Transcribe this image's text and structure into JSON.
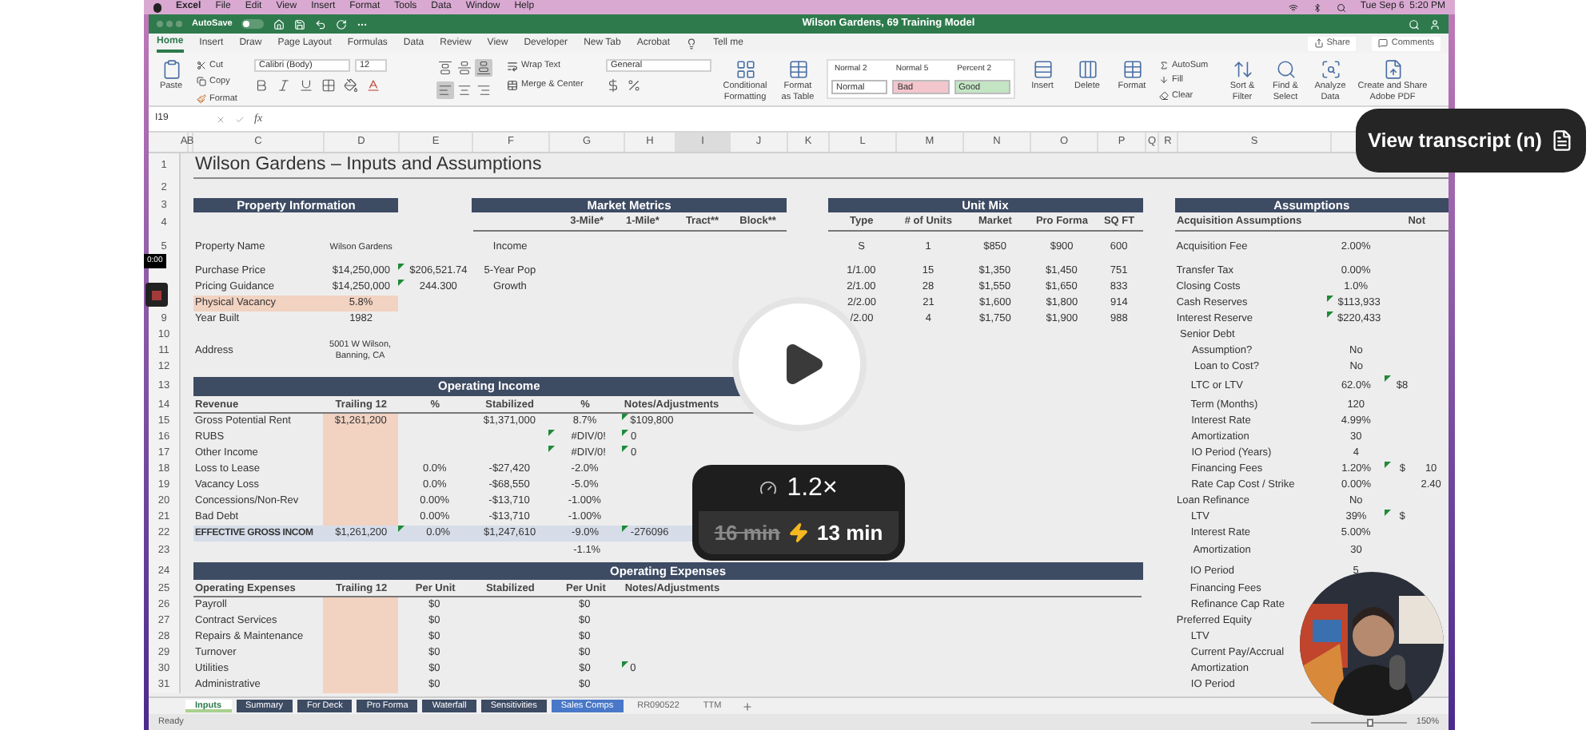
{
  "menubar": {
    "items": [
      "Excel",
      "File",
      "Edit",
      "View",
      "Insert",
      "Format",
      "Tools",
      "Data",
      "Window",
      "Help"
    ],
    "clock": "Tue Sep 6  5:20 PM"
  },
  "titlebar": {
    "autosave": "AutoSave",
    "autosave_on": false,
    "title": "Wilson Gardens, 69 Training Model"
  },
  "ribbon_tabs": [
    {
      "label": "Home",
      "selected": true
    },
    {
      "label": "Insert",
      "selected": false
    },
    {
      "label": "Draw",
      "selected": false
    },
    {
      "label": "Page Layout",
      "selected": false
    },
    {
      "label": "Formulas",
      "selected": false
    },
    {
      "label": "Data",
      "selected": false
    },
    {
      "label": "Review",
      "selected": false
    },
    {
      "label": "View",
      "selected": false
    },
    {
      "label": "Developer",
      "selected": false
    },
    {
      "label": "New Tab",
      "selected": false
    },
    {
      "label": "Acrobat",
      "selected": false
    }
  ],
  "tell_me": "Tell me",
  "share": "Share",
  "comments": "Comments",
  "ribbon": {
    "paste": "Paste",
    "cut": "Cut",
    "copy": "Copy",
    "format_painter": "Format",
    "font_name": "Calibri (Body)",
    "font_size": "12",
    "vertical_align": [
      {
        "kind": "top",
        "selected": false
      },
      {
        "kind": "middle",
        "selected": false
      },
      {
        "kind": "bottom",
        "selected": true
      }
    ],
    "horizontal_align": [
      {
        "kind": "left",
        "selected": true
      },
      {
        "kind": "center",
        "selected": false
      },
      {
        "kind": "right",
        "selected": false
      }
    ],
    "wrap_text": "Wrap Text",
    "merge_center": "Merge & Center",
    "number_format": "General",
    "conditional_formatting": "Conditional Formatting",
    "format_as_table": "Format as Table",
    "styles": [
      {
        "label": "Normal 2"
      },
      {
        "label": "Normal 5"
      },
      {
        "label": "Percent 2"
      },
      {
        "label": "Normal",
        "color": "#ffffff"
      },
      {
        "label": "Bad",
        "color": "#f3c5cc"
      },
      {
        "label": "Good",
        "color": "#c3e5c4"
      }
    ],
    "insert": "Insert",
    "delete": "Delete",
    "format": "Format",
    "autosum": "AutoSum",
    "fill": "Fill",
    "clear": "Clear",
    "sort_filter": "Sort & Filter",
    "find_select": "Find & Select",
    "analyze_data": "Analyze Data",
    "adobe_pdf": "Create and Share Adobe PDF"
  },
  "formula_bar": {
    "cell": "I19",
    "fx": "fx"
  },
  "sheet": {
    "columns": [
      "A",
      "B",
      "C",
      "D",
      "E",
      "F",
      "G",
      "H",
      "I",
      "J",
      "K",
      "L",
      "M",
      "N",
      "O",
      "P",
      "Q",
      "R",
      "S"
    ],
    "rows": [
      {
        "number": "1",
        "cells": [
          {
            "kind": "title",
            "text": "Wilson Gardens – Inputs and Assumptions"
          }
        ]
      },
      {
        "number": "2"
      },
      {
        "number": "3",
        "cells": [
          {
            "kind": "band",
            "text": "Property Information"
          },
          {
            "kind": "band",
            "text": "Market Metrics"
          },
          {
            "kind": "band",
            "text": "Unit Mix"
          },
          {
            "kind": "band",
            "text": "Assumptions"
          }
        ]
      },
      {
        "number": "4",
        "cells": [
          {
            "kind": "head"
          },
          {
            "kind": "head",
            "text": "3-Mile*"
          },
          {
            "kind": "head",
            "text": "1-Mile*"
          },
          {
            "kind": "head",
            "text": "Tract**"
          },
          {
            "kind": "head",
            "text": "Block**"
          },
          {
            "kind": "head",
            "text": "Type"
          },
          {
            "kind": "head",
            "text": "# of Units"
          },
          {
            "kind": "head",
            "text": "Market"
          },
          {
            "kind": "head",
            "text": "Pro Forma"
          },
          {
            "kind": "head",
            "text": "SQ FT"
          },
          {
            "kind": "head",
            "text": "Acquisition Assumptions"
          },
          {
            "kind": "head"
          },
          {
            "kind": "head",
            "text": "Not"
          }
        ]
      },
      {
        "number": "5",
        "cells": [
          {
            "text": "Property Name"
          },
          {
            "kind": "small",
            "text": "Wilson Gardens"
          },
          {
            "text": "Income"
          },
          {
            "text": "S"
          },
          {
            "text": "1"
          },
          {
            "text": "$850"
          },
          {
            "text": "$900"
          },
          {
            "text": "600"
          },
          {
            "text": "Acquisition Fee"
          },
          {
            "text": "2.00%"
          }
        ]
      },
      {
        "cells": [
          {
            "text": "Purchase Price"
          },
          {
            "text": "$14,250,000"
          },
          {
            "text": "$206,521.74",
            "comment": true
          },
          {
            "text": "5-Year Pop"
          },
          {
            "text": "1/1.00"
          },
          {
            "text": "15"
          },
          {
            "text": "$1,350"
          },
          {
            "text": "$1,450"
          },
          {
            "text": "751"
          },
          {
            "text": "Transfer Tax"
          },
          {
            "text": "0.00%"
          }
        ]
      },
      {
        "cells": [
          {
            "text": "Pricing Guidance"
          },
          {
            "text": "$14,250,000"
          },
          {
            "text": "244.300",
            "comment": true
          },
          {
            "text": "Growth"
          },
          {
            "text": "2/1.00"
          },
          {
            "text": "28"
          },
          {
            "text": "$1,550"
          },
          {
            "text": "$1,650"
          },
          {
            "text": "833"
          },
          {
            "text": "Closing Costs"
          },
          {
            "text": "1.0%"
          }
        ]
      },
      {
        "cells": [
          {
            "text": "Physical Vacancy",
            "input": true
          },
          {
            "text": "5.8%",
            "input": true
          },
          {
            "text": "2/2.00"
          },
          {
            "text": "21"
          },
          {
            "text": "$1,600"
          },
          {
            "text": "$1,800"
          },
          {
            "text": "914"
          },
          {
            "text": "Cash Reserves"
          },
          {
            "text": "$113,933",
            "comment": true
          }
        ]
      },
      {
        "number": "9",
        "cells": [
          {
            "text": "Year Built"
          },
          {
            "text": "1982"
          },
          {
            "text": "/2.00"
          },
          {
            "text": "4"
          },
          {
            "text": "$1,750"
          },
          {
            "text": "$1,900"
          },
          {
            "text": "988"
          },
          {
            "text": "Interest Reserve"
          },
          {
            "text": "$220,433",
            "comment": true
          }
        ]
      },
      {
        "number": "10",
        "cells": [
          {
            "text": "Senior Debt"
          }
        ]
      },
      {
        "number": "11",
        "cells": [
          {
            "text": "Address"
          },
          {
            "kind": "wrap",
            "text": "5001 W Wilson, Banning, CA"
          },
          {
            "kind": "sub",
            "text": "Assumption?"
          },
          {
            "text": "No"
          }
        ]
      },
      {
        "number": "12",
        "cells": [
          {
            "kind": "sub",
            "text": "Loan to Cost?"
          },
          {
            "text": "No"
          }
        ]
      },
      {
        "number": "13",
        "cells": [
          {
            "kind": "band",
            "text": "Operating Income"
          },
          {
            "kind": "sub",
            "text": "LTC or LTV"
          },
          {
            "text": "62.0%"
          },
          {
            "text": "$8",
            "comment": true
          }
        ]
      },
      {
        "number": "14",
        "cells": [
          {
            "kind": "head",
            "text": "Revenue"
          },
          {
            "kind": "head",
            "text": "Trailing 12"
          },
          {
            "kind": "head",
            "text": "%"
          },
          {
            "kind": "head",
            "text": "Stabilized"
          },
          {
            "kind": "head",
            "text": "%"
          },
          {
            "kind": "head",
            "text": "Notes/Adjustments"
          },
          {
            "kind": "sub",
            "text": "Term (Months)"
          },
          {
            "text": "120"
          }
        ]
      },
      {
        "number": "15",
        "cells": [
          {
            "text": "Gross Potential Rent"
          },
          {
            "text": "$1,261,200",
            "input": true
          },
          {
            "text": "$1,371,000"
          },
          {
            "text": "8.7%"
          },
          {
            "text": "$109,800",
            "comment": true
          },
          {
            "kind": "sub",
            "text": "Interest Rate"
          },
          {
            "text": "4.99%"
          }
        ]
      },
      {
        "number": "16",
        "cells": [
          {
            "text": "RUBS"
          },
          {
            "input": true
          },
          {
            "text": "#DIV/0!",
            "comment": true
          },
          {
            "text": "0",
            "comment": true
          },
          {
            "kind": "sub",
            "text": "Amortization"
          },
          {
            "text": "30"
          }
        ]
      },
      {
        "number": "17",
        "cells": [
          {
            "text": "Other Income"
          },
          {
            "input": true
          },
          {
            "text": "#DIV/0!",
            "comment": true
          },
          {
            "text": "0",
            "comment": true
          },
          {
            "kind": "sub",
            "text": "IO Period (Years)"
          },
          {
            "text": "4"
          }
        ]
      },
      {
        "number": "18",
        "cells": [
          {
            "text": "Loss to Lease"
          },
          {
            "input": true
          },
          {
            "text": "0.0%"
          },
          {
            "text": "-$27,420"
          },
          {
            "text": "-2.0%"
          },
          {
            "kind": "sub",
            "text": "Financing Fees"
          },
          {
            "text": "1.20%"
          },
          {
            "text": "$",
            "comment": true
          },
          {
            "text": "10"
          }
        ]
      },
      {
        "number": "19",
        "cells": [
          {
            "text": "Vacancy Loss"
          },
          {
            "input": true
          },
          {
            "text": "0.0%"
          },
          {
            "text": "-$68,550"
          },
          {
            "text": "-5.0%"
          },
          {
            "kind": "sub",
            "text": "Rate Cap Cost / Strike"
          },
          {
            "text": "0.00%"
          },
          {
            "text": "2.40"
          }
        ]
      },
      {
        "number": "20",
        "cells": [
          {
            "text": "Concessions/Non-Rev"
          },
          {
            "input": true
          },
          {
            "text": "0.00%"
          },
          {
            "text": "-$13,710"
          },
          {
            "text": "-1.00%"
          },
          {
            "text": "Loan Refinance"
          },
          {
            "text": "No"
          }
        ]
      },
      {
        "number": "21",
        "cells": [
          {
            "text": "Bad Debt"
          },
          {
            "input": true
          },
          {
            "text": "0.00%"
          },
          {
            "text": "-$13,710"
          },
          {
            "text": "-1.00%"
          },
          {
            "kind": "sub",
            "text": "LTV"
          },
          {
            "text": "39%"
          },
          {
            "text": "$",
            "comment": true
          }
        ]
      },
      {
        "number": "22",
        "cells": [
          {
            "text": "EFFECTIVE GROSS INCOM",
            "bold": true,
            "highlight": true
          },
          {
            "text": "$1,261,200",
            "highlight": true
          },
          {
            "text": "0.0%",
            "highlight": true,
            "comment": true
          },
          {
            "text": "$1,247,610",
            "highlight": true
          },
          {
            "text": "-9.0%",
            "highlight": true
          },
          {
            "text": "-276096",
            "highlight": true,
            "comment": true
          },
          {
            "highlight": true
          },
          {
            "kind": "sub",
            "text": "Interest Rate"
          },
          {
            "text": "5.00%"
          }
        ]
      },
      {
        "number": "23",
        "cells": [
          {
            "text": "-1.1%"
          },
          {
            "kind": "sub",
            "text": "Amortization"
          },
          {
            "text": "30"
          }
        ]
      },
      {
        "number": "24",
        "cells": [
          {
            "kind": "band",
            "text": "Operating Expenses"
          },
          {
            "kind": "sub",
            "text": "IO Period"
          },
          {
            "text": "5"
          }
        ]
      },
      {
        "number": "25",
        "cells": [
          {
            "kind": "head",
            "text": "Operating Expenses"
          },
          {
            "kind": "head",
            "text": "Trailing 12"
          },
          {
            "kind": "head",
            "text": "Per Unit"
          },
          {
            "kind": "head",
            "text": "Stabilized"
          },
          {
            "kind": "head",
            "text": "Per Unit"
          },
          {
            "kind": "head",
            "text": "Notes/Adjustments"
          },
          {
            "kind": "sub",
            "text": "Financing Fees"
          }
        ]
      },
      {
        "number": "26",
        "cells": [
          {
            "text": "Payroll"
          },
          {
            "input": true
          },
          {
            "text": "$0"
          },
          {
            "text": "$0"
          },
          {
            "kind": "sub",
            "text": "Refinance Cap Rate"
          }
        ]
      },
      {
        "number": "27",
        "cells": [
          {
            "text": "Contract Services"
          },
          {
            "input": true
          },
          {
            "text": "$0"
          },
          {
            "text": "$0"
          },
          {
            "text": "Preferred Equity"
          }
        ]
      },
      {
        "number": "28",
        "cells": [
          {
            "text": "Repairs & Maintenance"
          },
          {
            "input": true
          },
          {
            "text": "$0"
          },
          {
            "text": "$0"
          },
          {
            "kind": "sub",
            "text": "LTV"
          }
        ]
      },
      {
        "number": "29",
        "cells": [
          {
            "text": "Turnover"
          },
          {
            "input": true
          },
          {
            "text": "$0"
          },
          {
            "text": "$0"
          },
          {
            "kind": "sub",
            "text": "Current Pay/Accrual"
          }
        ]
      },
      {
        "number": "30",
        "cells": [
          {
            "text": "Utilities"
          },
          {
            "input": true
          },
          {
            "text": "$0"
          },
          {
            "text": "$0"
          },
          {
            "text": "0",
            "comment": true
          },
          {
            "kind": "sub",
            "text": "Amortization"
          }
        ]
      },
      {
        "number": "31",
        "cells": [
          {
            "text": "Administrative"
          },
          {
            "input": true
          },
          {
            "text": "$0"
          },
          {
            "text": "$0"
          },
          {
            "kind": "sub",
            "text": "IO Period"
          }
        ]
      }
    ]
  },
  "sheet_tabs": [
    {
      "label": "Inputs",
      "selected": true,
      "color": "#a9d08e"
    },
    {
      "label": "Summary",
      "selected": false,
      "color": "#3d4b63"
    },
    {
      "label": "For Deck",
      "selected": false,
      "color": "#3d4b63"
    },
    {
      "label": "Pro Forma",
      "selected": false,
      "color": "#3d4b63"
    },
    {
      "label": "Waterfall",
      "selected": false,
      "color": "#3d4b63"
    },
    {
      "label": "Sensitivities",
      "selected": false,
      "color": "#3d4b63"
    },
    {
      "label": "Sales Comps",
      "selected": false,
      "color": "#4a78c8"
    },
    {
      "label": "RR090522",
      "selected": false
    },
    {
      "label": "TTM",
      "selected": false
    }
  ],
  "status": {
    "text": "Ready",
    "zoom": "150%",
    "zoom_slider": {
      "level": 0.62
    }
  },
  "player": {
    "time": "0:00",
    "transcript": "View transcript (n)",
    "rate": "1.2×",
    "old_duration": "16 min",
    "new_duration": "13 min"
  }
}
